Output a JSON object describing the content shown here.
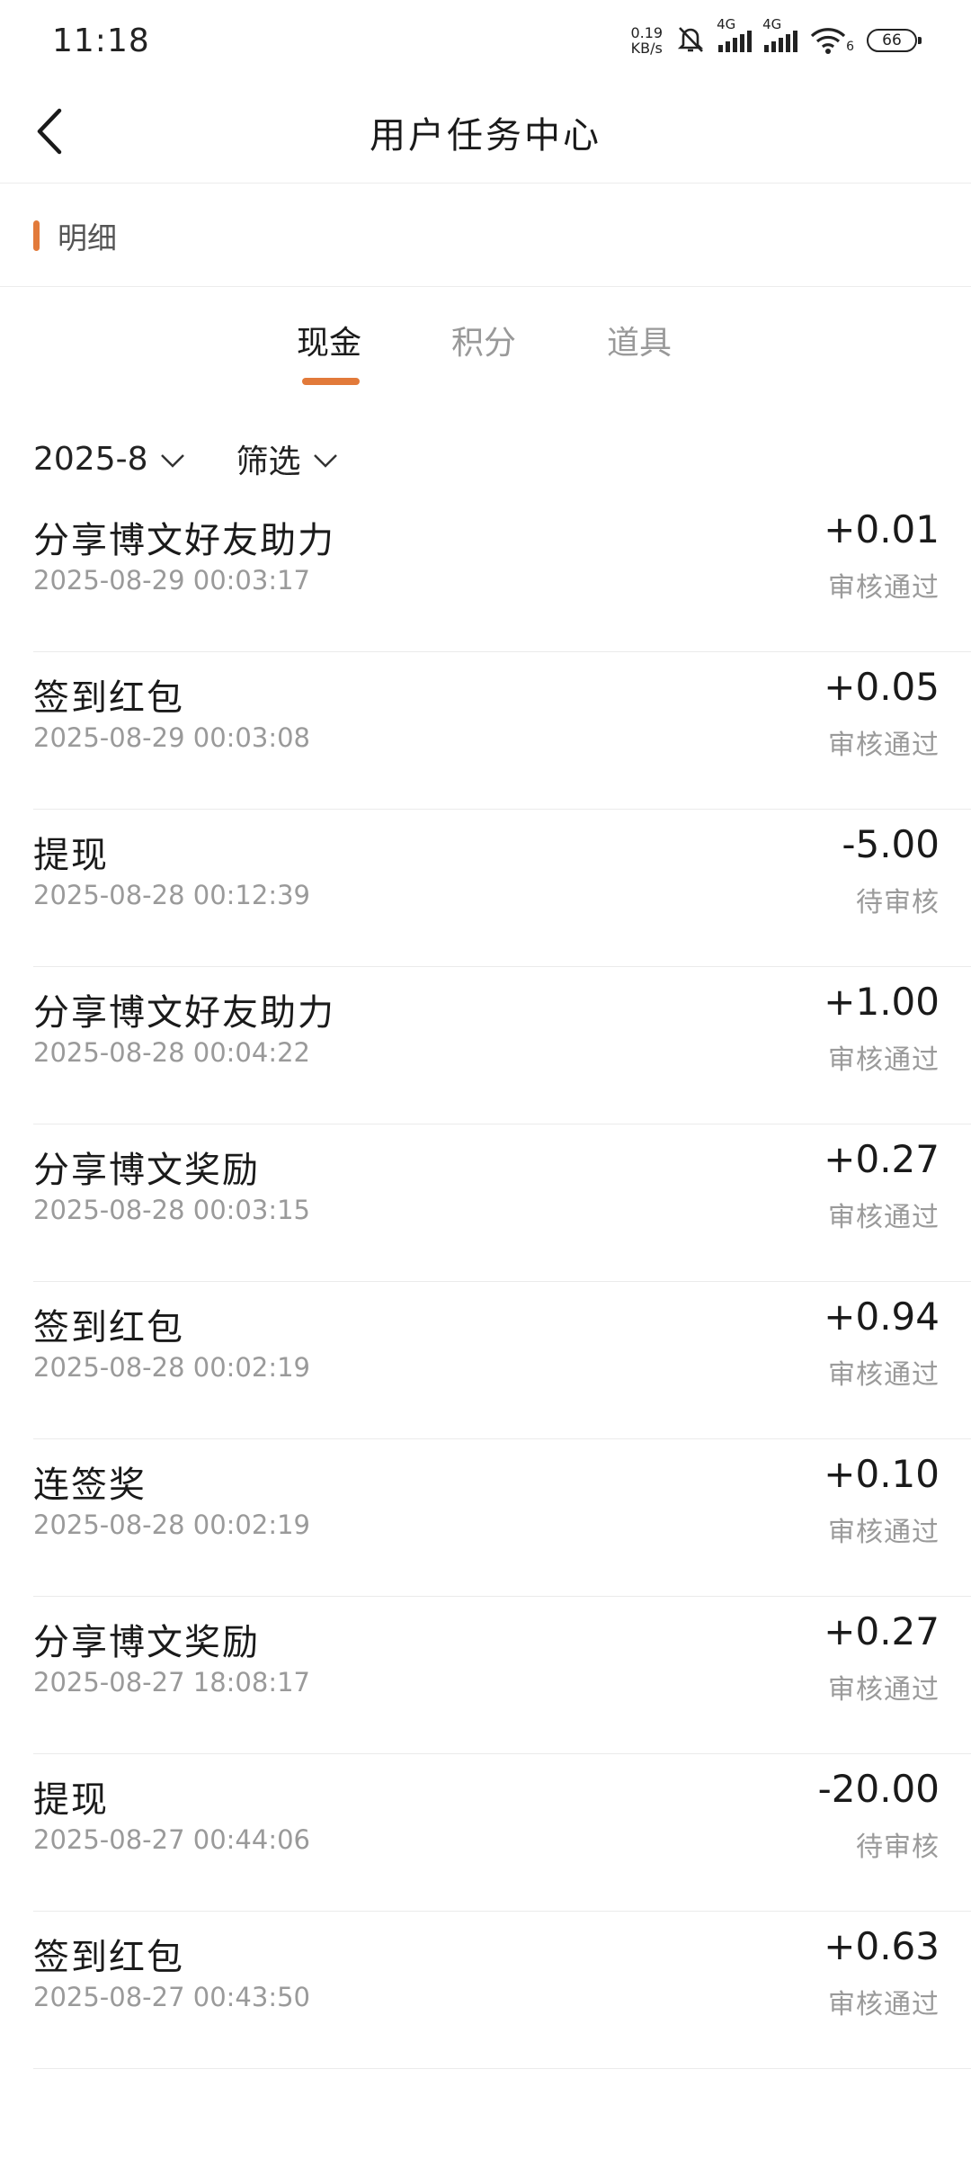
{
  "status_bar": {
    "time": "11:18",
    "net_speed_value": "0.19",
    "net_speed_unit": "KB/s",
    "signal1": "4G",
    "signal2": "4G",
    "wifi_sub": "6",
    "battery": "66"
  },
  "nav": {
    "title": "用户任务中心"
  },
  "section": {
    "title": "明细"
  },
  "tabs": [
    {
      "label": "现金",
      "active": true
    },
    {
      "label": "积分"
    },
    {
      "label": "道具"
    }
  ],
  "filters": {
    "month": "2025-8",
    "filter": "筛选"
  },
  "records": [
    {
      "title": "分享博文好友助力",
      "time": "2025-08-29 00:03:17",
      "amount": "+0.01",
      "status": "审核通过"
    },
    {
      "title": "签到红包",
      "time": "2025-08-29 00:03:08",
      "amount": "+0.05",
      "status": "审核通过"
    },
    {
      "title": "提现",
      "time": "2025-08-28 00:12:39",
      "amount": "-5.00",
      "status": "待审核"
    },
    {
      "title": "分享博文好友助力",
      "time": "2025-08-28 00:04:22",
      "amount": "+1.00",
      "status": "审核通过"
    },
    {
      "title": "分享博文奖励",
      "time": "2025-08-28 00:03:15",
      "amount": "+0.27",
      "status": "审核通过"
    },
    {
      "title": "签到红包",
      "time": "2025-08-28 00:02:19",
      "amount": "+0.94",
      "status": "审核通过"
    },
    {
      "title": "连签奖",
      "time": "2025-08-28 00:02:19",
      "amount": "+0.10",
      "status": "审核通过"
    },
    {
      "title": "分享博文奖励",
      "time": "2025-08-27 18:08:17",
      "amount": "+0.27",
      "status": "审核通过"
    },
    {
      "title": "提现",
      "time": "2025-08-27 00:44:06",
      "amount": "-20.00",
      "status": "待审核"
    },
    {
      "title": "签到红包",
      "time": "2025-08-27 00:43:50",
      "amount": "+0.63",
      "status": "审核通过"
    }
  ],
  "colors": {
    "accent": "#e27a3a",
    "text": "#1a1a1a",
    "muted": "#9a9a9a",
    "divider": "#ebebeb"
  }
}
